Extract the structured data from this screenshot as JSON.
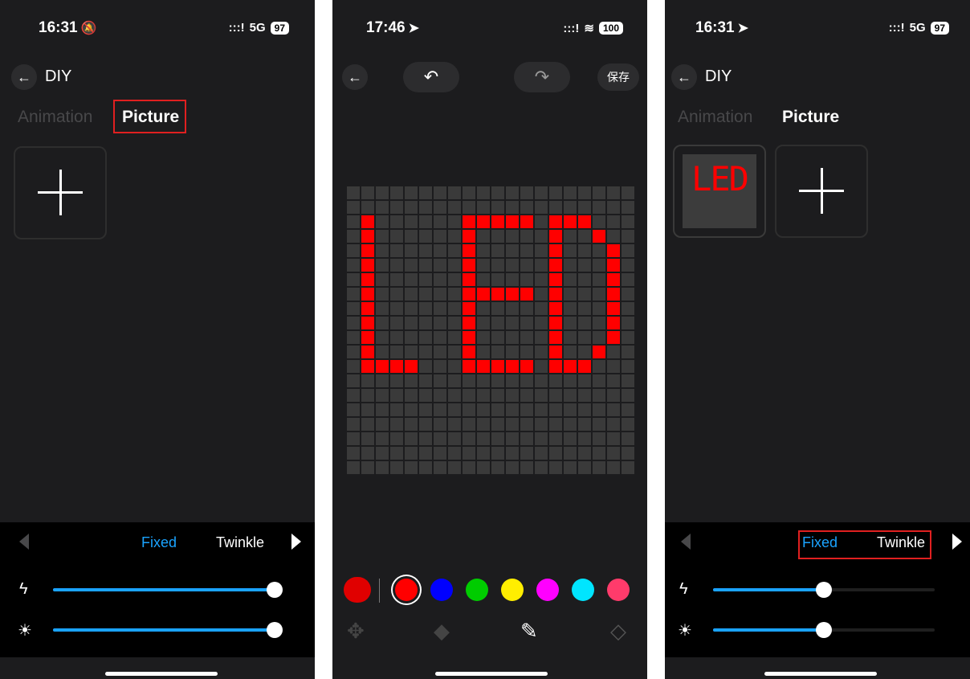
{
  "screen1": {
    "status": {
      "time": "16:31",
      "network": "5G",
      "battery": "97"
    },
    "title": "DIY",
    "tabs": {
      "animation": "Animation",
      "picture": "Picture"
    },
    "modes": {
      "fixed": "Fixed",
      "twinkle": "Twinkle"
    },
    "sliders": {
      "speed": 1.0,
      "brightness": 1.0
    }
  },
  "screen2": {
    "status": {
      "time": "17:46",
      "battery": "100"
    },
    "save_label": "保存",
    "matrix": {
      "cols": 20,
      "rows": 20,
      "off_color": "#3a3a3a",
      "on_color": "#ff0000",
      "lit_rows": [
        "00000000000000000000",
        "00000000000000000000",
        "01000000111110111000",
        "01000000100000100100",
        "01000000100000100010",
        "01000000100000100010",
        "01000000100000100010",
        "01000000111110100010",
        "01000000100000100010",
        "01000000100000100010",
        "01000000100000100010",
        "01000000100000100100",
        "01111000111110111000",
        "00000000000000000000",
        "00000000000000000000",
        "00000000000000000000",
        "00000000000000000000",
        "00000000000000000000",
        "00000000000000000000",
        "00000000000000000000"
      ]
    },
    "palette": [
      "#ff0000",
      "#0000ff",
      "#00cc00",
      "#ffee00",
      "#ff00ff",
      "#00e5ff",
      "#ff3b6b"
    ],
    "selected_color": "#ff0000"
  },
  "screen3": {
    "status": {
      "time": "16:31",
      "network": "5G",
      "battery": "97"
    },
    "title": "DIY",
    "tabs": {
      "animation": "Animation",
      "picture": "Picture"
    },
    "thumbnail_text": "LED",
    "modes": {
      "fixed": "Fixed",
      "twinkle": "Twinkle"
    },
    "sliders": {
      "speed": 0.5,
      "brightness": 0.5
    }
  },
  "colors": {
    "accent": "#1aa3ff",
    "highlight_box": "#e02020",
    "background": "#1c1c1e"
  }
}
